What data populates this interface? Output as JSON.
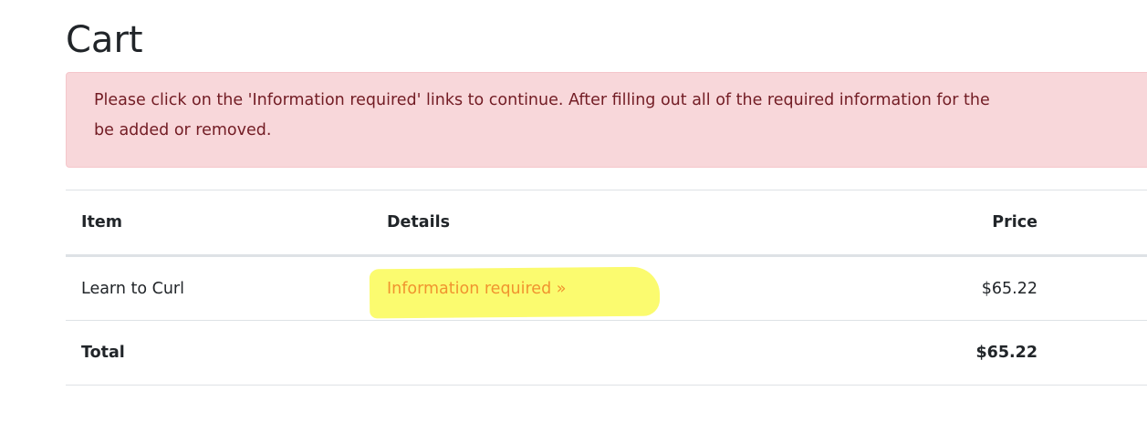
{
  "page": {
    "title": "Cart"
  },
  "alert": {
    "line1": "Please click on the 'Information required' links to continue. After filling out all of the required information for the",
    "line2": "be added or removed."
  },
  "table": {
    "headers": {
      "item": "Item",
      "details": "Details",
      "price": "Price"
    },
    "rows": [
      {
        "item": "Learn to Curl",
        "details_link": "Information required »",
        "price": "$65.22"
      }
    ],
    "total": {
      "label": "Total",
      "price": "$65.22"
    }
  },
  "colors": {
    "alert_bg": "#f8d7da",
    "alert_text": "#721c24",
    "link": "#f0942f",
    "highlight": "#fbfb6f"
  }
}
